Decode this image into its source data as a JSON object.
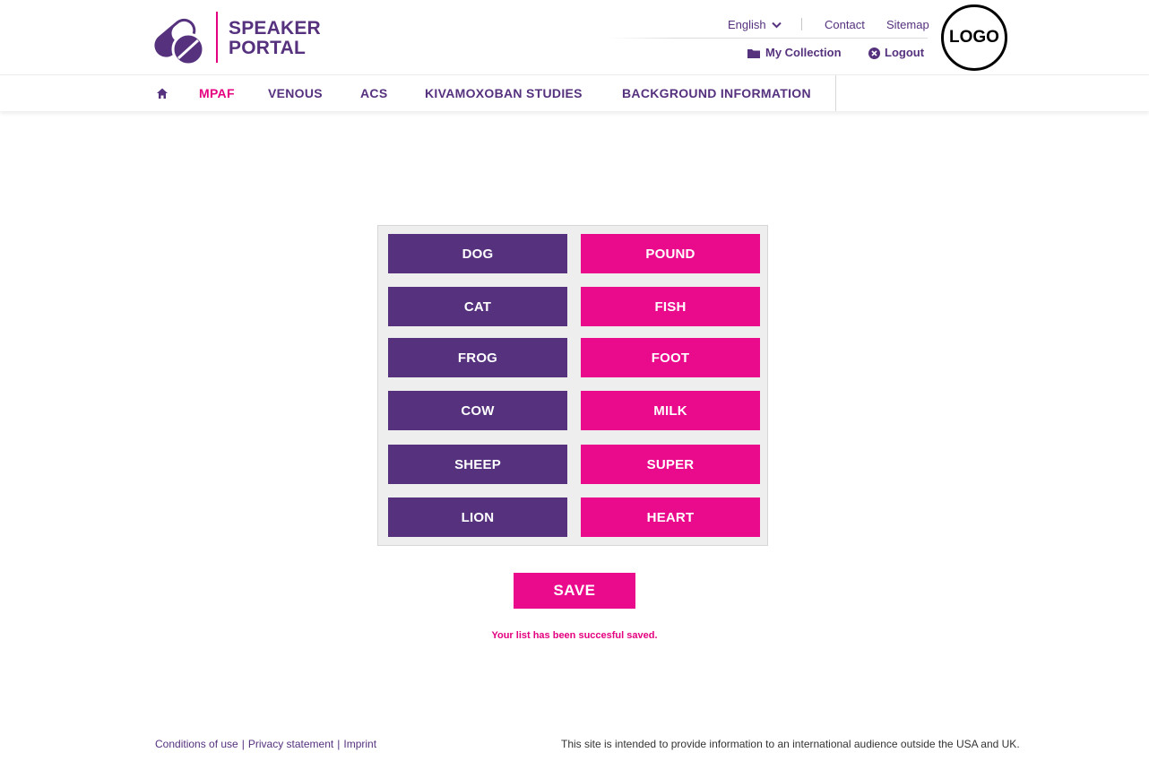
{
  "brand": {
    "line1": "SPEAKER",
    "line2": "PORTAL",
    "logo_text": "LOGO"
  },
  "colors": {
    "purple": "#55317e",
    "pink": "#ea0a8c",
    "accent": "#e4007f"
  },
  "header": {
    "language": "English",
    "contact": "Contact",
    "sitemap": "Sitemap",
    "my_collection": "My Collection",
    "logout": "Logout"
  },
  "nav": {
    "home_icon": "home-icon",
    "items": [
      {
        "label": "MPAF",
        "active": true
      },
      {
        "label": "VENOUS",
        "active": false
      },
      {
        "label": "ACS",
        "active": false
      },
      {
        "label": "KIVAMOXOBAN STUDIES",
        "active": false
      },
      {
        "label": "BACKGROUND INFORMATION",
        "active": false
      }
    ]
  },
  "grid": {
    "left": [
      "DOG",
      "CAT",
      "FROG",
      "COW",
      "SHEEP",
      "LION"
    ],
    "right": [
      "POUND",
      "FISH",
      "FOOT",
      "MILK",
      "SUPER",
      "HEART"
    ]
  },
  "save": {
    "label": "SAVE",
    "message": "Your list has been succesful saved."
  },
  "footer": {
    "links": [
      "Conditions of use",
      "Privacy statement",
      "Imprint"
    ],
    "separator": "|",
    "note": "This site is intended to provide information to an international audience outside the USA and UK."
  }
}
